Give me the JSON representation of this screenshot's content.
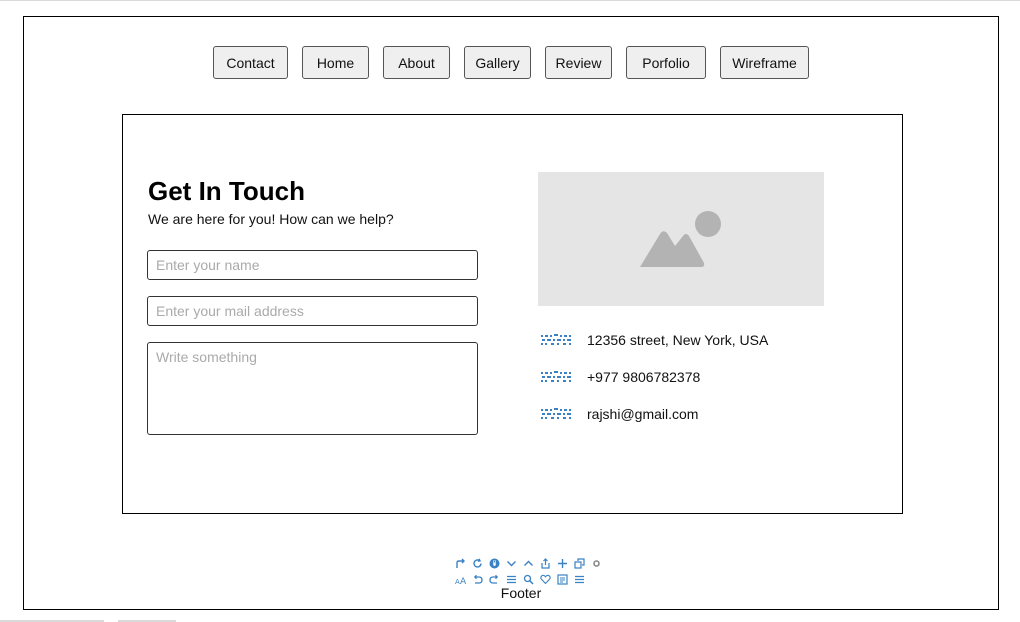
{
  "nav": {
    "items": [
      {
        "label": "Contact"
      },
      {
        "label": "Home"
      },
      {
        "label": "About"
      },
      {
        "label": "Gallery"
      },
      {
        "label": "Review"
      },
      {
        "label": "Porfolio"
      },
      {
        "label": "Wireframe"
      }
    ]
  },
  "contact": {
    "title": "Get In Touch",
    "subtitle": "We are here for you! How can we help?",
    "name_placeholder": "Enter your name",
    "email_placeholder": "Enter your mail address",
    "message_placeholder": "Write something"
  },
  "image_placeholder": {
    "icon": "image-placeholder-icon"
  },
  "info": {
    "address": {
      "icon": "broken-image-icon",
      "text": "12356 street, New York, USA"
    },
    "phone": {
      "icon": "broken-image-icon",
      "text": "+977 9806782378"
    },
    "email": {
      "icon": "broken-image-icon",
      "text": "rajshi@gmail.com"
    }
  },
  "footer": {
    "label": "Footer",
    "toolbar": [
      "redo-arrow-icon",
      "refresh-icon",
      "mouse-icon",
      "chevron-down-icon",
      "chevron-up-icon",
      "share-icon",
      "plus-icon",
      "duplicate-icon",
      "settings-dot-icon",
      "text-size-icon",
      "undo-icon",
      "redo-icon",
      "align-icon",
      "search-icon",
      "heart-icon",
      "copy-icon",
      "menu-icon"
    ]
  },
  "colors": {
    "accent_icon": "#3a82c4",
    "placeholder_bg": "#e5e5e5",
    "placeholder_fg": "#b3b3b3"
  }
}
